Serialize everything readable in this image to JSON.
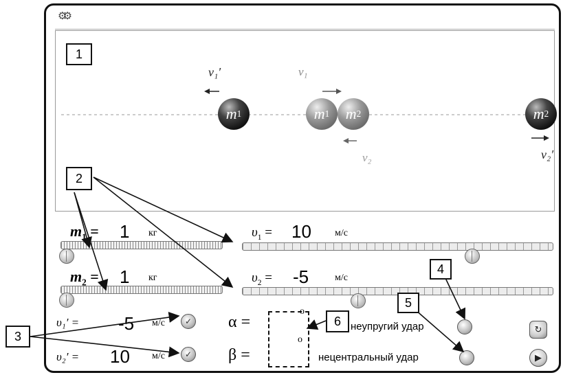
{
  "callouts": [
    "1",
    "2",
    "3",
    "4",
    "5",
    "6"
  ],
  "simulation": {
    "labels": {
      "v1_prime": "v₁′",
      "v1": "v₁",
      "v2": "v₂",
      "v2_prime": "v₂′",
      "m1": "m",
      "m2": "m",
      "sub1": "1",
      "sub2": "2"
    }
  },
  "controls": {
    "m1": {
      "label": "m",
      "sub": "1",
      "eq": "=",
      "value": "1",
      "unit": "кг"
    },
    "m2": {
      "label": "m",
      "sub": "2",
      "eq": "=",
      "value": "1",
      "unit": "кг"
    },
    "v1": {
      "label": "υ",
      "sub": "1",
      "eq": "=",
      "value": "10",
      "unit": "м/с",
      "slider_fraction": 0.65
    },
    "v2": {
      "label": "υ",
      "sub": "2",
      "eq": "=",
      "value": "-5",
      "unit": "м/с",
      "slider_fraction": 0.36
    }
  },
  "results": {
    "v1_prime": {
      "label": "υ₁′ =",
      "value": "-5",
      "unit": "м/с"
    },
    "v2_prime": {
      "label": "υ₂′ =",
      "value": "10",
      "unit": "м/с"
    },
    "alpha": {
      "label": "α =",
      "unit": "о"
    },
    "beta": {
      "label": "β =",
      "unit": "о"
    }
  },
  "options": {
    "inelastic": "неупругий удар",
    "noncentral": "нецентральный удар"
  },
  "icons": {
    "settings": "gears-icon",
    "reset": "reset-icon",
    "play": "play-icon"
  }
}
